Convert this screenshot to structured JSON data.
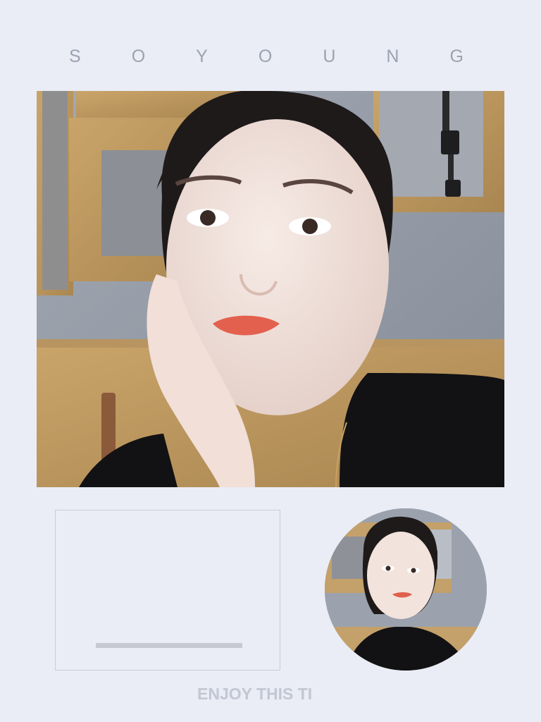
{
  "brand": {
    "letters": [
      "S",
      "O",
      "Y",
      "O",
      "U",
      "N",
      "G"
    ]
  },
  "tagline": "ENJOY THIS TI",
  "colors": {
    "background": "#eaedf5",
    "brand_text": "#9ea1b1",
    "tagline_text": "#c3c6d3",
    "frame_border": "#c9ccd6",
    "bar": "#c6c9d3"
  }
}
